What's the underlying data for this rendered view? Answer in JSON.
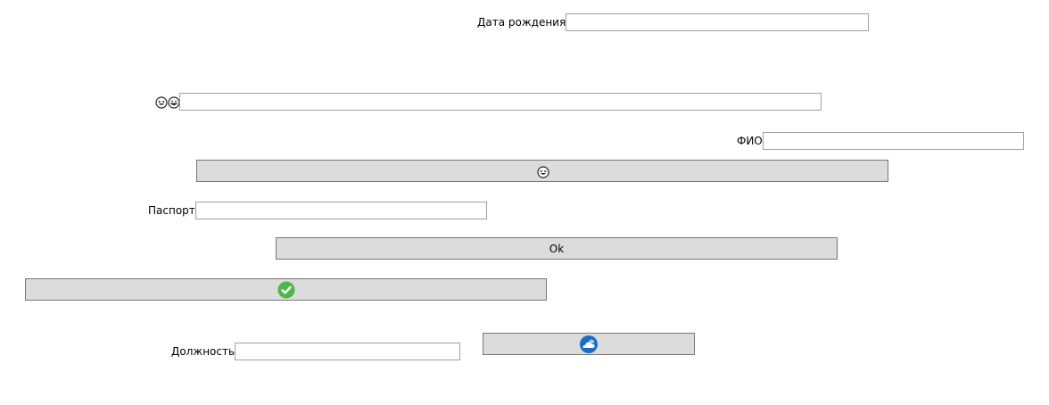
{
  "fields": {
    "birth_date": {
      "label": "Дата рождения",
      "value": ""
    },
    "emoji_field": {
      "value": ""
    },
    "fio": {
      "label": "ФИО",
      "value": ""
    },
    "passport": {
      "label": "Паспорт",
      "value": ""
    },
    "position": {
      "label": "Должность",
      "value": ""
    }
  },
  "buttons": {
    "ok_label": "Ok"
  },
  "icons": {
    "emoji_label": [
      "laughing-emoji-icon",
      "grinning-emoji-icon"
    ],
    "laugh_button": "laughing-emoji-icon",
    "check_button": "green-check-icon",
    "cloud_button": "blue-cloud-icon"
  },
  "colors": {
    "button_bg": "#dcdcdc",
    "button_border": "#777777",
    "field_border": "#a0a0a0",
    "check_green": "#4db848",
    "cloud_blue": "#1a6fc4"
  }
}
